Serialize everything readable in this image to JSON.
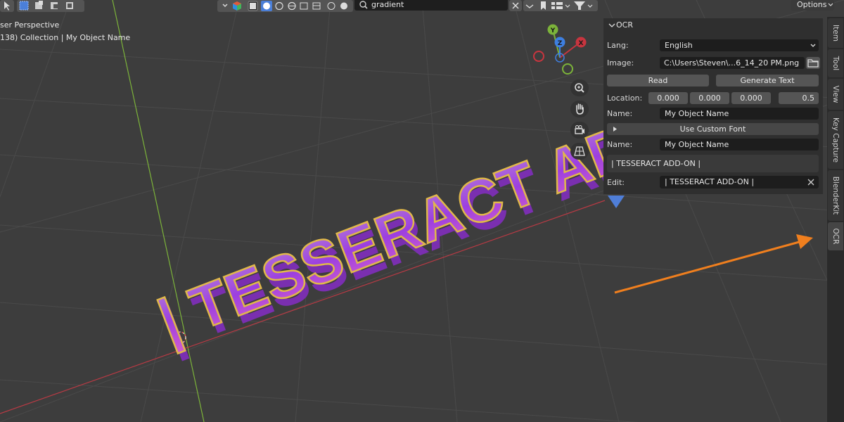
{
  "viewport": {
    "perspective_label": "ser Perspective",
    "collection_label": "138) Collection | My Object Name",
    "object_text": "| TESSERACT ADD-ON"
  },
  "header": {
    "search_value": "gradient",
    "options_label": "Options"
  },
  "gizmo": {
    "y_label": "Y",
    "z_label": "Z",
    "x_label": "X"
  },
  "panel": {
    "title": "OCR",
    "lang_label": "Lang:",
    "lang_value": "English",
    "image_label": "Image:",
    "image_value": "C:\\Users\\Steven\\...6_14_20 PM.png",
    "read_button": "Read",
    "generate_button": "Generate Text",
    "location_label": "Location:",
    "location_x": "0.000",
    "location_y": "0.000",
    "location_z": "0.000",
    "scale_value": "0.5",
    "name_label": "Name:",
    "name_value": "My Object Name",
    "custom_font_label": "Use Custom Font",
    "name2_label": "Name:",
    "name2_value": "My Object Name",
    "text_preview": "| TESSERACT ADD-ON |",
    "edit_label": "Edit:",
    "edit_value": "| TESSERACT ADD-ON |"
  },
  "sidebar_tabs": [
    "Item",
    "Tool",
    "View",
    "Key Capture",
    "BlenderKit",
    "OCR"
  ],
  "colors": {
    "x_axis": "#c8353f",
    "y_axis": "#7cb33a",
    "z_axis": "#3e7fe0",
    "text_fill": "#a855d8",
    "text_outline": "#e0b84a",
    "arrow": "#f07f1e"
  },
  "icons": {
    "lang_dropdown": "chevron-down-icon",
    "image_browse": "folder-icon",
    "custom_font_toggle": "triangle-right-icon",
    "edit_clear": "close-icon"
  }
}
